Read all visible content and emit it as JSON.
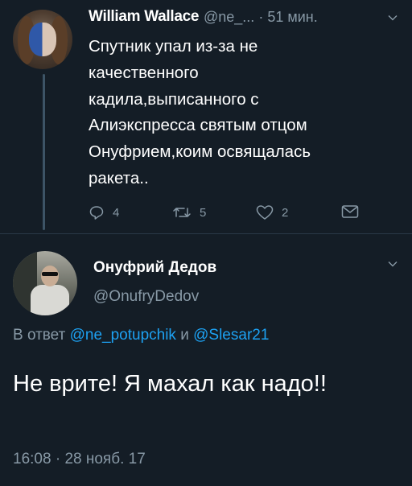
{
  "tweet": {
    "author_name": "William Wallace",
    "author_handle": "@ne_...",
    "separator": "·",
    "time_ago": "51 мин.",
    "text": "Спутник упал из-за не\nкачественного\nкадила,выписанного с\nАлиэкспресса святым отцом\nОнуфрием,коим освящалась\nракета..",
    "replies": "4",
    "retweets": "5",
    "likes": "2"
  },
  "reply": {
    "author_name": "Онуфрий Дедов",
    "author_handle": "@OnufryDedov",
    "reply_prefix": "В ответ",
    "mention1": "@ne_potupchik",
    "conjunction": "и",
    "mention2": "@Slesar21",
    "text": "Не врите! Я махал как надо!!",
    "time": "16:08",
    "date": "28 нояб. 17"
  },
  "colors": {
    "background": "#141d26",
    "secondary_text": "#8899a6",
    "link": "#1da1f2"
  },
  "icons": [
    "chevron-down-icon",
    "reply-icon",
    "retweet-icon",
    "like-icon",
    "direct-message-icon"
  ]
}
